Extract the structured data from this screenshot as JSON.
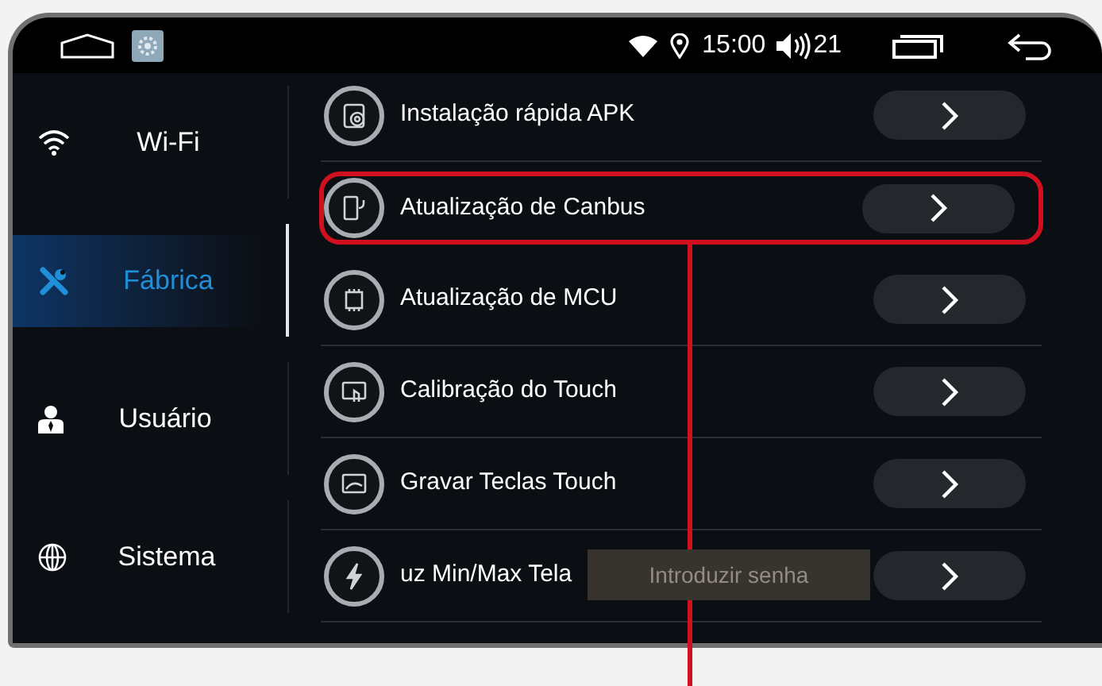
{
  "status_bar": {
    "time": "15:00",
    "volume": "21"
  },
  "sidebar": {
    "items": [
      {
        "label": "Wi-Fi",
        "selected": false
      },
      {
        "label": "Fábrica",
        "selected": true
      },
      {
        "label": "Usuário",
        "selected": false
      },
      {
        "label": "Sistema",
        "selected": false
      }
    ]
  },
  "list": {
    "items": [
      {
        "label": "Instalação rápida APK",
        "highlighted": false
      },
      {
        "label": "Atualização de Canbus",
        "highlighted": true
      },
      {
        "label": "Atualização de MCU",
        "highlighted": false
      },
      {
        "label": "Calibração do Touch",
        "highlighted": false
      },
      {
        "label": "Gravar Teclas Touch",
        "highlighted": false
      },
      {
        "label": "uz Min/Max Tela",
        "highlighted": false
      }
    ]
  },
  "toast": {
    "text": "Introduzir senha"
  }
}
